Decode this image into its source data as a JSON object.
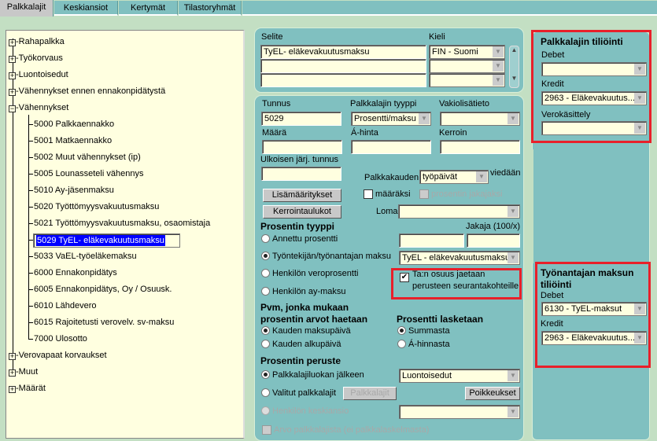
{
  "tabs": [
    "Palkkalajit",
    "Keskiansiot",
    "Kertymät",
    "Tilastoryhmät"
  ],
  "active_tab": "Palkkalajit",
  "tree": {
    "groups_top": [
      "Rahapalkka",
      "Työkorvaus",
      "Luontoisedut",
      "Vähennykset ennen ennakonpidätystä"
    ],
    "expanded_group": "Vähennykset",
    "children": [
      "5000 Palkkaennakko",
      "5001 Matkaennakko",
      "5002 Muut vähennykset (ip)",
      "5005 Lounasseteli vähennys",
      "5010 Ay-jäsenmaksu",
      "5020 Työttömyysvakuutusmaksu",
      "5021 Työttömyysvakuutusmaksu, osaomistaja",
      "5029 TyEL- eläkevakuutusmaksu",
      "5033 VaEL-työeläkemaksu",
      "6000 Ennakonpidätys",
      "6005 Ennakonpidätys, Oy / Osuusk.",
      "6010 Lähdevero",
      "6015 Rajoitetusti verovelv. sv-maksu",
      "7000 Ulosotto"
    ],
    "selected_child": "5029 TyEL- eläkevakuutusmaksu",
    "groups_bottom": [
      "Verovapaat korvaukset",
      "Muut",
      "Määrät"
    ]
  },
  "description": {
    "selite_label": "Selite",
    "kieli_label": "Kieli",
    "selite_value": "TyEL- eläkevakuutusmaksu",
    "kieli_value": "FIN - Suomi"
  },
  "form": {
    "tunnus_label": "Tunnus",
    "tunnus_value": "5029",
    "tyyppi_label": "Palkkalajin tyyppi",
    "tyyppi_value": "Prosentti/maksu",
    "vakio_label": "Vakiolisätieto",
    "maara_label": "Määrä",
    "ahinta_label": "Á-hinta",
    "kerroin_label": "Kerroin",
    "ulkoinen_label": "Ulkoisen järj. tunnus",
    "palkkakauden_label": "Palkkakauden",
    "palkkakauden_value": "työpäivät",
    "viedaan_label": "viedään",
    "lisamaaritykset_button": "Lisämääritykset",
    "kerrointaulukot_button": "Kerrointaulukot",
    "maaraksi_label": "määräksi",
    "maaraksi_checked": false,
    "jakajaksi_label": "prosentin jakajaksi",
    "loma_label": "Loma",
    "prosentin_tyyppi_title": "Prosentin tyyppi",
    "jakaja_label": "Jakaja (100/x)",
    "tyyppi_options": [
      "Annettu prosentti",
      "Työntekijän/työnantajan maksu",
      "Henkilön veroprosentti",
      "Henkilön ay-maksu"
    ],
    "tyyppi_selected": "Työntekijän/työnantajan maksu",
    "maksu_value": "TyEL - eläkevakuutusmaksu",
    "seuranta_checkbox_label_1": "Ta:n osuus jaetaan",
    "seuranta_checkbox_label_2": "perusteen seurantakohteille",
    "seuranta_checked": true,
    "pvm_title_1": "Pvm, jonka mukaan",
    "pvm_title_2": "prosentin arvot haetaan",
    "pvm_options": [
      "Kauden maksupäivä",
      "Kauden alkupäivä"
    ],
    "pvm_selected": "Kauden maksupäivä",
    "lasketaan_title": "Prosentti lasketaan",
    "lasketaan_options": [
      "Summasta",
      "Á-hinnasta"
    ],
    "lasketaan_selected": "Summasta",
    "peruste_title": "Prosentin peruste",
    "peruste_options": [
      "Palkkalajiluokan jälkeen",
      "Valitut palkkalajit",
      "Henkilön keskiansio"
    ],
    "peruste_selected": "Palkkalajiluokan jälkeen",
    "luokka_value": "Luontoisedut",
    "palkkalajit_button": "Palkkalajit",
    "poikkeukset_button": "Poikkeukset",
    "arvo_checkbox_label": "Arvo palkkalajista (ei palkkalaskelmasta)"
  },
  "tiliointi": {
    "title": "Palkkalajin tiliöinti",
    "debet_label": "Debet",
    "debet_value": "",
    "kredit_label": "Kredit",
    "kredit_value": "2963 - Eläkevakuutus...",
    "vero_label": "Verokäsittely",
    "vero_value": ""
  },
  "tyonantaja": {
    "title_1": "Työnantajan maksun",
    "title_2": "tiliöinti",
    "debet_label": "Debet",
    "debet_value": "6130 - TyEL-maksut",
    "kredit_label": "Kredit",
    "kredit_value": "2963 - Eläkevakuutus..."
  },
  "colors": {
    "panel": "#80c0c0",
    "background": "#c3dfc3",
    "input": "#ffffe0",
    "highlight": "#e8202a",
    "selection": "#0000ff"
  }
}
